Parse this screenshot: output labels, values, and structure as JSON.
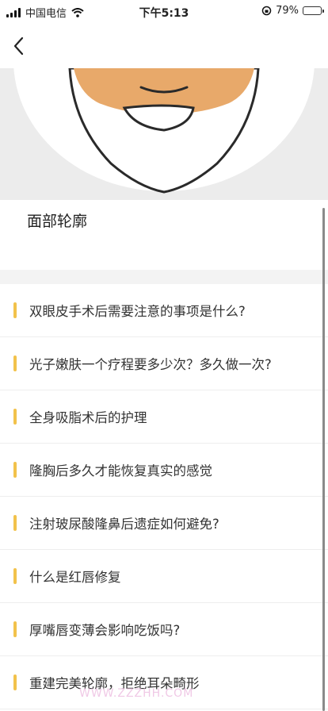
{
  "status": {
    "carrier": "中国电信",
    "time": "下午5:13",
    "battery": "79%",
    "battery_level": 0.79
  },
  "nav": {
    "back_icon": "chevron-left-icon"
  },
  "hero": {
    "image": "face-contour-illustration"
  },
  "category": {
    "title": "面部轮廓"
  },
  "faq": {
    "items": [
      {
        "text": "双眼皮手术后需要注意的事项是什么?"
      },
      {
        "text": "光子嫩肤一个疗程要多少次？多久做一次?"
      },
      {
        "text": "全身吸脂术后的护理"
      },
      {
        "text": "隆胸后多久才能恢复真实的感觉"
      },
      {
        "text": "注射玻尿酸隆鼻后遗症如何避免?"
      },
      {
        "text": "什么是红唇修复"
      },
      {
        "text": "厚嘴唇变薄会影响吃饭吗?"
      },
      {
        "text": "重建完美轮廓，拒绝耳朵畸形"
      }
    ]
  },
  "colors": {
    "accent": "#f2c24b",
    "skin": "#e8a96a"
  },
  "watermark": "WWW.ZZZHH.COM"
}
